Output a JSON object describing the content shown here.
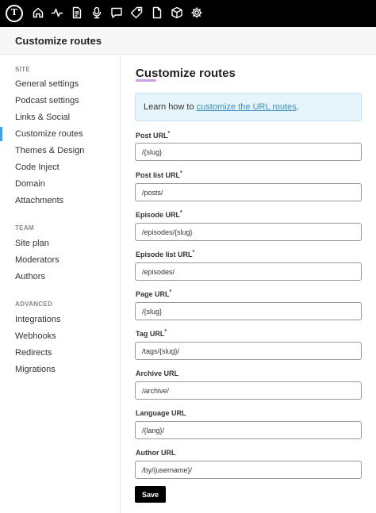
{
  "topbar": {
    "logo_letter": "T",
    "icons": [
      "home-icon",
      "activity-icon",
      "document-icon",
      "microphone-icon",
      "comment-icon",
      "tag-icon",
      "page-icon",
      "cube-icon",
      "gear-icon"
    ]
  },
  "header": {
    "title": "Customize routes"
  },
  "sidebar": {
    "site_title": "SITE",
    "site_items": [
      {
        "label": "General settings"
      },
      {
        "label": "Podcast settings"
      },
      {
        "label": "Links & Social"
      },
      {
        "label": "Customize routes",
        "active": true
      },
      {
        "label": "Themes & Design"
      },
      {
        "label": "Code Inject"
      },
      {
        "label": "Domain"
      },
      {
        "label": "Attachments"
      }
    ],
    "team_title": "TEAM",
    "team_items": [
      {
        "label": "Site plan"
      },
      {
        "label": "Moderators"
      },
      {
        "label": "Authors"
      }
    ],
    "advanced_title": "ADVANCED",
    "advanced_items": [
      {
        "label": "Integrations"
      },
      {
        "label": "Webhooks"
      },
      {
        "label": "Redirects"
      },
      {
        "label": "Migrations"
      }
    ]
  },
  "main": {
    "title": "Customize routes",
    "info": {
      "prefix": "Learn how to ",
      "link": "customize the URL routes",
      "suffix": "."
    },
    "fields": [
      {
        "label": "Post URL",
        "required": true,
        "value": "/{slug}"
      },
      {
        "label": "Post list URL",
        "required": true,
        "value": "/posts/"
      },
      {
        "label": "Episode URL",
        "required": true,
        "value": "/episodes/{slug}"
      },
      {
        "label": "Episode list URL",
        "required": true,
        "value": "/episodes/"
      },
      {
        "label": "Page URL",
        "required": true,
        "value": "/{slug}"
      },
      {
        "label": "Tag URL",
        "required": true,
        "value": "/tags/{slug}/"
      },
      {
        "label": "Archive URL",
        "required": false,
        "value": "/archive/"
      },
      {
        "label": "Language URL",
        "required": false,
        "value": "/{lang}/"
      },
      {
        "label": "Author URL",
        "required": false,
        "value": "/by/{username}/"
      }
    ],
    "required_mark": "*",
    "save_label": "Save"
  }
}
